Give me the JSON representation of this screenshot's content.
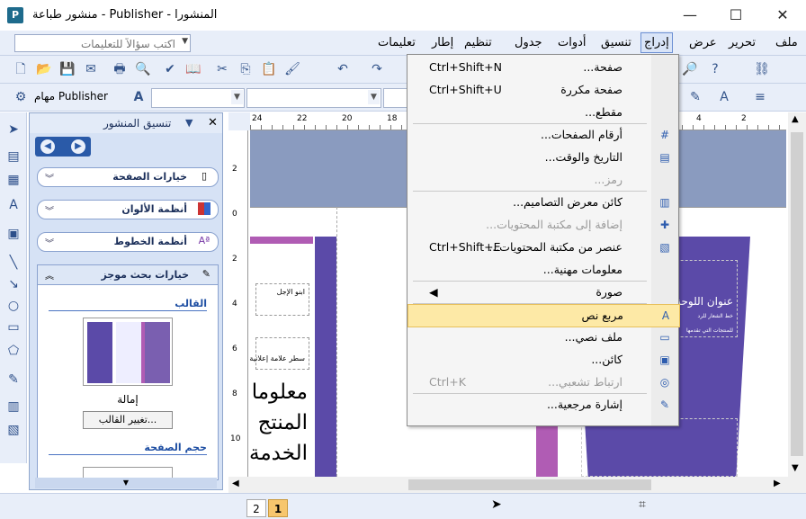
{
  "window": {
    "title": "منشور طباعة - Publisher - المنشورا",
    "minimize": "—",
    "maximize": "☐",
    "close": "✕"
  },
  "menubar": {
    "items": [
      "ملف",
      "تحرير",
      "عرض",
      "إدراج",
      "تنسيق",
      "أدوات",
      "جدول",
      "تنظيم",
      "إطار",
      "تعليمات"
    ],
    "active": "إدراج",
    "ask_placeholder": "اكتب سؤالاً للتعليمات"
  },
  "toolbar": {
    "tasks_label": "مهام Publisher"
  },
  "taskpane": {
    "title": "تنسيق المنشور",
    "sections": [
      "خيارات الصفحة",
      "أنظمة الألوان",
      "أنظمة الخطوط",
      "خيارات بحث موجز"
    ],
    "template_heading": "القالب",
    "template_name": "إمالة",
    "change_template_button": "تغيير القالب...",
    "page_size_heading": "حجم الصفحة"
  },
  "ruler": {
    "h_ticks": [
      "24",
      "22",
      "20",
      "18",
      "4",
      "2"
    ],
    "v_ticks": [
      "2",
      "0",
      "2",
      "4",
      "6",
      "8",
      "10"
    ]
  },
  "canvas": {
    "text_1": "ابنو الإجل",
    "text_2": "سطر علامة إعلانية",
    "text_large": "معلومات المنتج الخدمة",
    "right_title": "عنوان اللوحة",
    "right_sub": "خط الشعار للرد",
    "right_sub2": "للمنتجات التي تقدمها"
  },
  "dropdown": {
    "items": [
      {
        "label": "صفحة...",
        "shortcut": "Ctrl+Shift+N",
        "icon": "",
        "disabled": false,
        "highlight": false
      },
      {
        "label": "صفحة مكررة",
        "shortcut": "Ctrl+Shift+U",
        "icon": "",
        "disabled": false,
        "highlight": false
      },
      {
        "label": "مقطع...",
        "shortcut": "",
        "icon": "",
        "disabled": false,
        "highlight": false
      },
      {
        "label": "أرقام الصفحات...",
        "shortcut": "",
        "icon": "page-number-icon",
        "disabled": false,
        "highlight": false
      },
      {
        "label": "التاريخ والوقت...",
        "shortcut": "",
        "icon": "date-time-icon",
        "disabled": false,
        "highlight": false
      },
      {
        "label": "رمز...",
        "shortcut": "",
        "icon": "",
        "disabled": true,
        "highlight": false
      },
      {
        "label": "كائن معرض التصاميم...",
        "shortcut": "",
        "icon": "design-gallery-icon",
        "disabled": false,
        "highlight": false
      },
      {
        "label": "إضافة إلى مكتبة المحتويات...",
        "shortcut": "",
        "icon": "add-content-library-icon",
        "disabled": true,
        "highlight": false
      },
      {
        "label": "عنصر من مكتبة المحتويات...",
        "shortcut": "Ctrl+Shift+E",
        "icon": "content-library-item-icon",
        "disabled": false,
        "highlight": false
      },
      {
        "label": "معلومات مهنية...",
        "shortcut": "",
        "icon": "",
        "disabled": false,
        "highlight": false
      },
      {
        "label": "صورة",
        "shortcut": "◀",
        "icon": "",
        "disabled": false,
        "highlight": false
      },
      {
        "label": "مربع نص",
        "shortcut": "",
        "icon": "text-box-icon",
        "disabled": false,
        "highlight": true
      },
      {
        "label": "ملف نصي...",
        "shortcut": "",
        "icon": "text-file-icon",
        "disabled": false,
        "highlight": false
      },
      {
        "label": "كائن...",
        "shortcut": "",
        "icon": "object-icon",
        "disabled": false,
        "highlight": false
      },
      {
        "label": "ارتباط تشعبي...",
        "shortcut": "Ctrl+K",
        "icon": "hyperlink-icon",
        "disabled": true,
        "highlight": false
      },
      {
        "label": "إشارة مرجعية...",
        "shortcut": "",
        "icon": "bookmark-icon",
        "disabled": false,
        "highlight": false
      }
    ]
  },
  "status": {
    "page_1": "1",
    "page_2": "2"
  },
  "colors": {
    "purple": "#5b4aa8",
    "magenta": "#b05cb4",
    "highlight": "#fde9a6"
  }
}
